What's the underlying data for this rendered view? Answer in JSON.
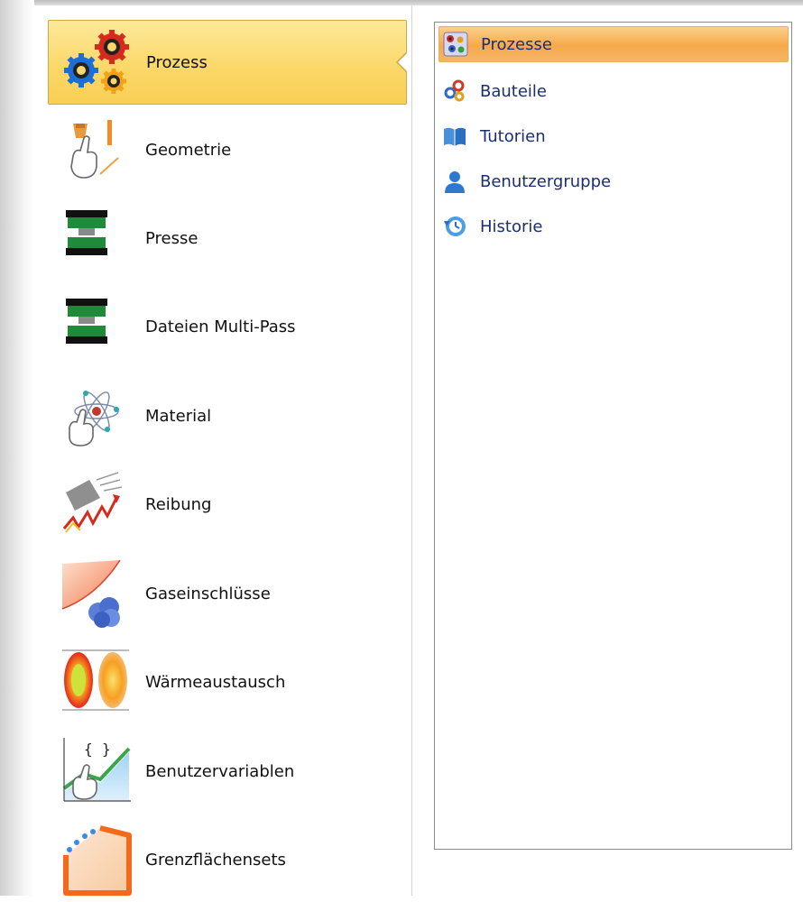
{
  "left_nav": {
    "items": [
      {
        "label": "Prozess",
        "icon": "gears-icon",
        "selected": true
      },
      {
        "label": "Geometrie",
        "icon": "geometry-hand-icon",
        "selected": false
      },
      {
        "label": "Presse",
        "icon": "press-icon",
        "selected": false
      },
      {
        "label": "Dateien Multi-Pass",
        "icon": "multipass-press-icon",
        "selected": false
      },
      {
        "label": "Material",
        "icon": "atom-hand-icon",
        "selected": false
      },
      {
        "label": "Reibung",
        "icon": "friction-icon",
        "selected": false
      },
      {
        "label": "Gaseinschlüsse",
        "icon": "gas-bubbles-icon",
        "selected": false
      },
      {
        "label": "Wärmeaustausch",
        "icon": "heat-exchange-icon",
        "selected": false
      },
      {
        "label": "Benutzervariablen",
        "icon": "user-variables-icon",
        "selected": false
      },
      {
        "label": "Grenzflächensets",
        "icon": "interface-sets-icon",
        "selected": false
      }
    ]
  },
  "sub_list": {
    "items": [
      {
        "label": "Prozesse",
        "icon": "processes-icon",
        "selected": true
      },
      {
        "label": "Bauteile",
        "icon": "parts-icon",
        "selected": false
      },
      {
        "label": "Tutorien",
        "icon": "tutorial-book-icon",
        "selected": false
      },
      {
        "label": "Benutzergruppe",
        "icon": "user-group-icon",
        "selected": false
      },
      {
        "label": "Historie",
        "icon": "history-icon",
        "selected": false
      }
    ]
  },
  "colors": {
    "selected_nav_bg": "#fbd86a",
    "selected_sub_bg": "#f7a94a",
    "sub_text": "#1a2e73"
  }
}
